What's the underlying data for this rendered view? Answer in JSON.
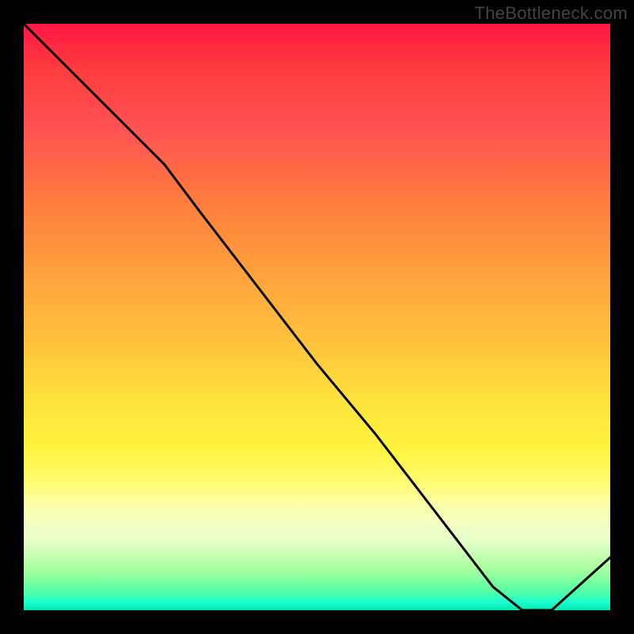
{
  "attribution": "TheBottleneck.com",
  "hint_label": "",
  "chart_data": {
    "type": "line",
    "title": "",
    "xlabel": "",
    "ylabel": "",
    "xlim": [
      0,
      100
    ],
    "ylim": [
      0,
      100
    ],
    "series": [
      {
        "name": "curve",
        "x": [
          0,
          10,
          20,
          24,
          30,
          40,
          50,
          60,
          70,
          80,
          85,
          90,
          100
        ],
        "values": [
          100,
          90,
          80,
          76,
          68,
          55,
          42,
          30,
          17,
          4,
          0,
          0,
          9
        ]
      }
    ],
    "gradient_stops": [
      {
        "pct": 0,
        "color": "#ff1744"
      },
      {
        "pct": 50,
        "color": "#ffd23d"
      },
      {
        "pct": 85,
        "color": "#fcffa8"
      },
      {
        "pct": 100,
        "color": "#00e8b0"
      }
    ]
  }
}
